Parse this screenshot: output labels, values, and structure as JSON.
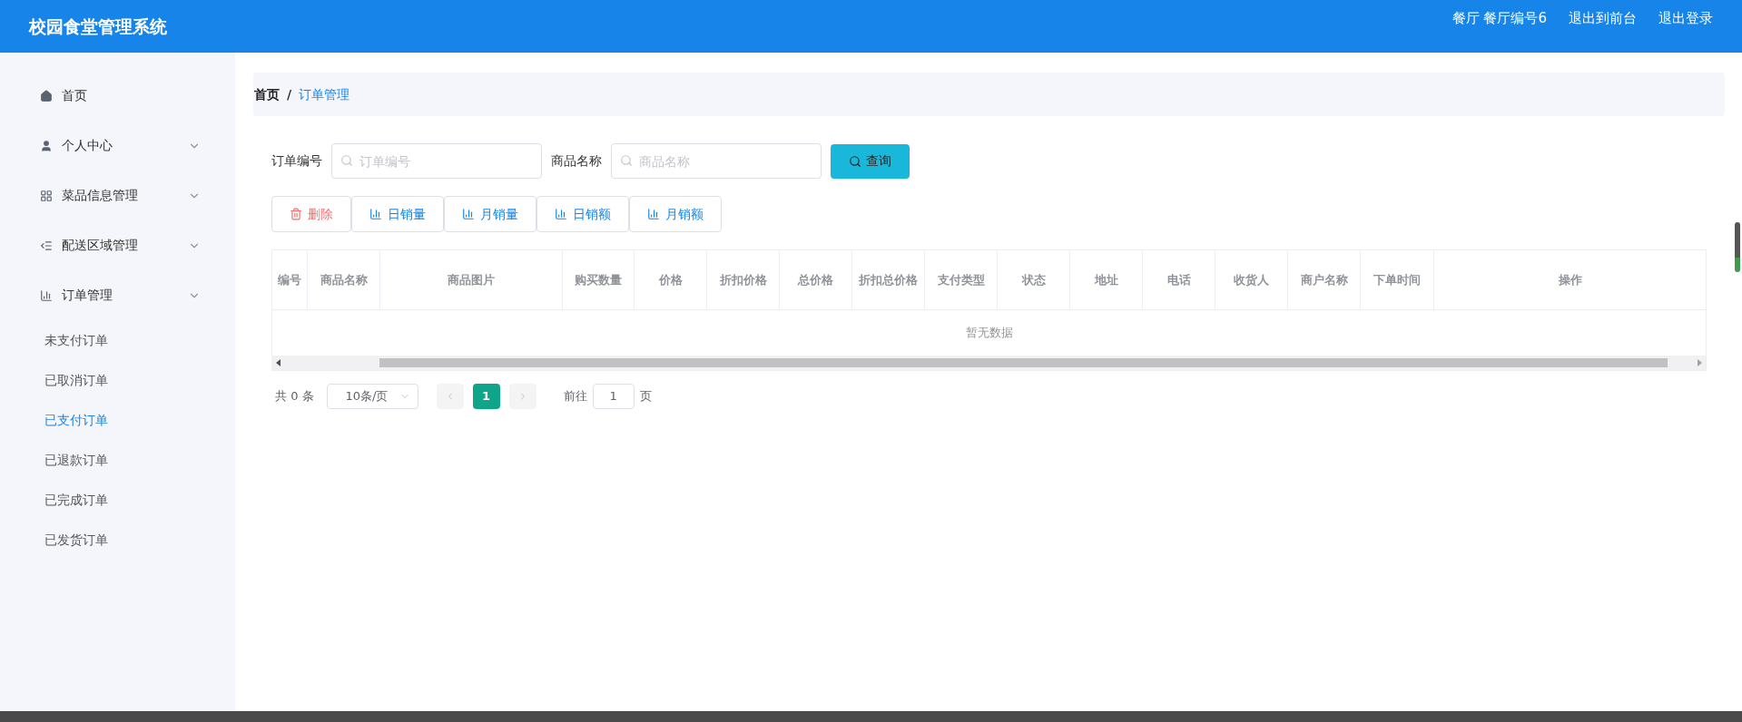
{
  "header": {
    "title": "校园食堂管理系统",
    "user": "餐厅 餐厅编号6",
    "links": [
      "退出到前台",
      "退出登录"
    ]
  },
  "sidebar": {
    "items": [
      {
        "label": "首页",
        "kind": "link"
      },
      {
        "label": "个人中心",
        "kind": "submenu"
      },
      {
        "label": "菜品信息管理",
        "kind": "submenu"
      },
      {
        "label": "配送区域管理",
        "kind": "submenu"
      },
      {
        "label": "订单管理",
        "kind": "submenu",
        "children": [
          {
            "label": "未支付订单",
            "selected": false
          },
          {
            "label": "已取消订单",
            "selected": false
          },
          {
            "label": "已支付订单",
            "selected": true
          },
          {
            "label": "已退款订单",
            "selected": false
          },
          {
            "label": "已完成订单",
            "selected": false
          },
          {
            "label": "已发货订单",
            "selected": false
          }
        ]
      }
    ]
  },
  "breadcrumb_separator": "/",
  "breadcrumb": [
    {
      "label": "首页",
      "current": false
    },
    {
      "label": "订单管理",
      "current": true
    }
  ],
  "search": {
    "fields": [
      {
        "label": "订单编号",
        "placeholder": "订单编号"
      },
      {
        "label": "商品名称",
        "placeholder": "商品名称"
      }
    ],
    "button": "查询"
  },
  "actions": [
    {
      "label": "删除",
      "kind": "danger"
    },
    {
      "label": "日销量",
      "kind": "chart"
    },
    {
      "label": "月销量",
      "kind": "chart"
    },
    {
      "label": "日销额",
      "kind": "chart"
    },
    {
      "label": "月销额",
      "kind": "chart"
    }
  ],
  "table": {
    "columns": [
      "编号",
      "商品名称",
      "商品图片",
      "购买数量",
      "价格",
      "折扣价格",
      "总价格",
      "折扣总价格",
      "支付类型",
      "状态",
      "地址",
      "电话",
      "收货人",
      "商户名称",
      "下单时间",
      "操作"
    ],
    "empty_text": "暂无数据"
  },
  "pagination": {
    "total": "共 0 条",
    "page_size": "10条/页",
    "pages": [
      {
        "label": "1",
        "selected": true
      }
    ],
    "goto_label": "前往",
    "goto_value": "1",
    "page_suffix": "页"
  }
}
